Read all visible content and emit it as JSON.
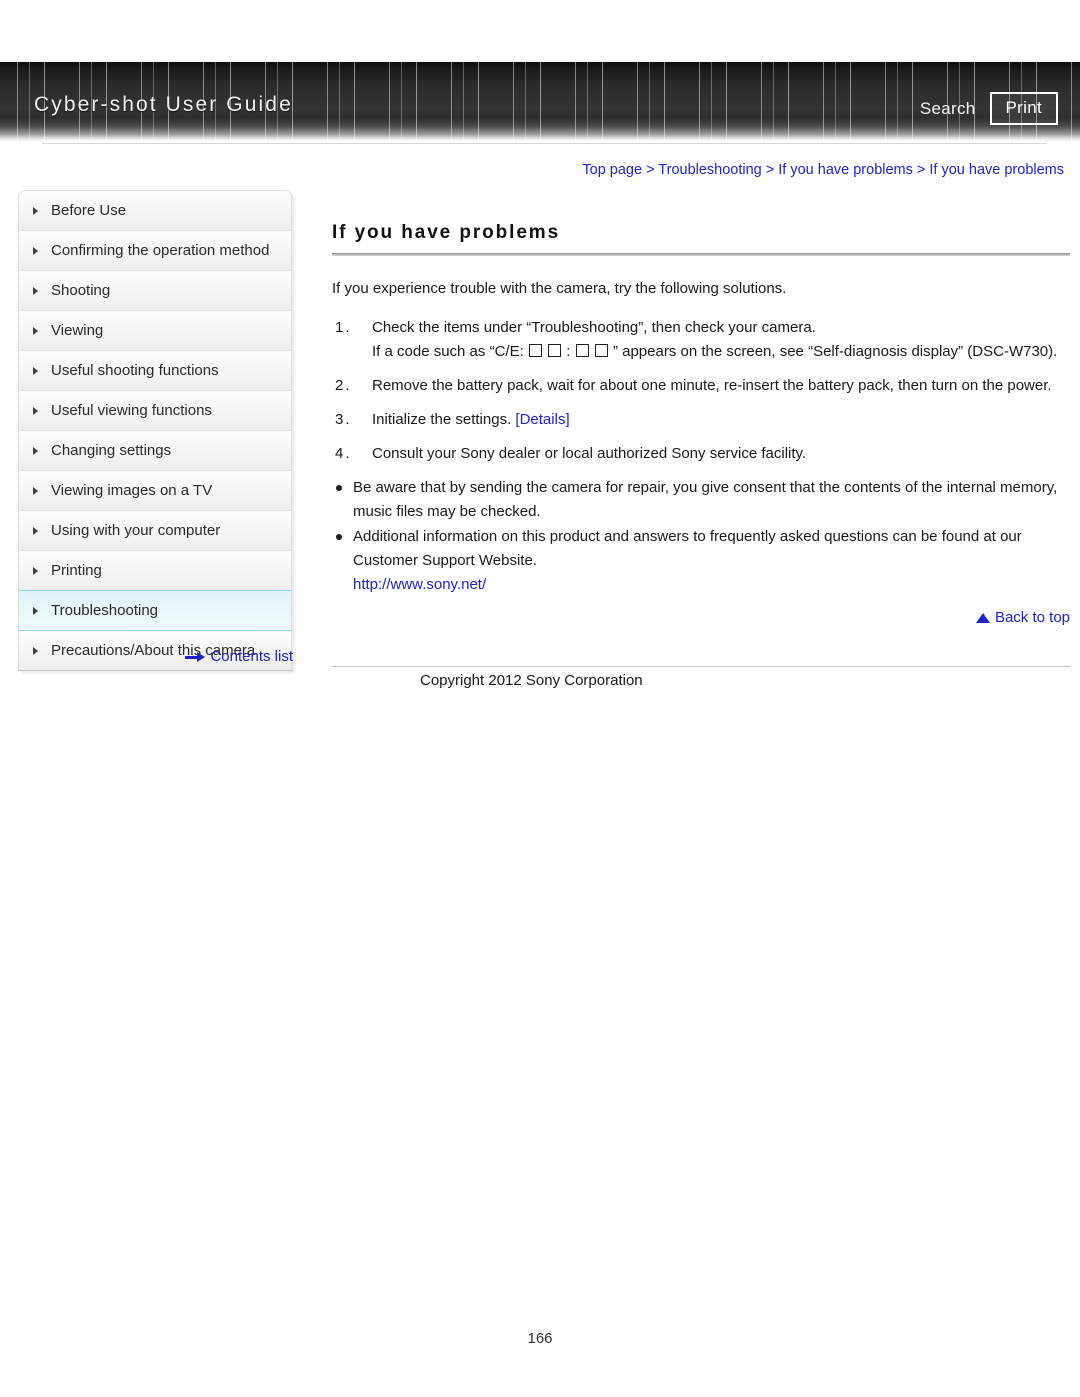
{
  "header": {
    "title": "Cyber-shot User Guide",
    "search_label": "Search",
    "print_label": "Print"
  },
  "breadcrumb": {
    "text": "Top page > Troubleshooting > If you have problems > If you have problems"
  },
  "sidebar": {
    "items": [
      {
        "label": "Before Use",
        "active": false
      },
      {
        "label": "Confirming the operation method",
        "active": false
      },
      {
        "label": "Shooting",
        "active": false
      },
      {
        "label": "Viewing",
        "active": false
      },
      {
        "label": "Useful shooting functions",
        "active": false
      },
      {
        "label": "Useful viewing functions",
        "active": false
      },
      {
        "label": "Changing settings",
        "active": false
      },
      {
        "label": "Viewing images on a TV",
        "active": false
      },
      {
        "label": "Using with your computer",
        "active": false
      },
      {
        "label": "Printing",
        "active": false
      },
      {
        "label": "Troubleshooting",
        "active": true
      },
      {
        "label": "Precautions/About this camera",
        "active": false
      }
    ],
    "contents_list_label": "Contents list"
  },
  "main": {
    "title": "If you have problems",
    "intro": "If you experience trouble with the camera, try the following solutions.",
    "steps": [
      {
        "num": "1.",
        "line1": "Check the items under “Troubleshooting”, then check your camera.",
        "line2_pre": "If a code such as “C/E:",
        "line2_mid": ":",
        "line2_post": "” appears on the screen, see “Self-diagnosis display” (DSC-W730)."
      },
      {
        "num": "2.",
        "line1": "Remove the battery pack, wait for about one minute, re-insert the battery pack, then turn on the power."
      },
      {
        "num": "3.",
        "line1": "Initialize the settings.",
        "link": "[Details]"
      },
      {
        "num": "4.",
        "line1": "Consult your Sony dealer or local authorized Sony service facility."
      }
    ],
    "notes": [
      {
        "text": "Be aware that by sending the camera for repair, you give consent that the contents of the internal memory, music files may be checked."
      },
      {
        "text": "Additional information on this product and answers to frequently asked questions can be found at our Customer Support Website.",
        "link": "http://www.sony.net/"
      }
    ],
    "back_to_top_label": "Back to top"
  },
  "footer": {
    "copyright": "Copyright 2012 Sony Corporation",
    "page_number": "166"
  }
}
